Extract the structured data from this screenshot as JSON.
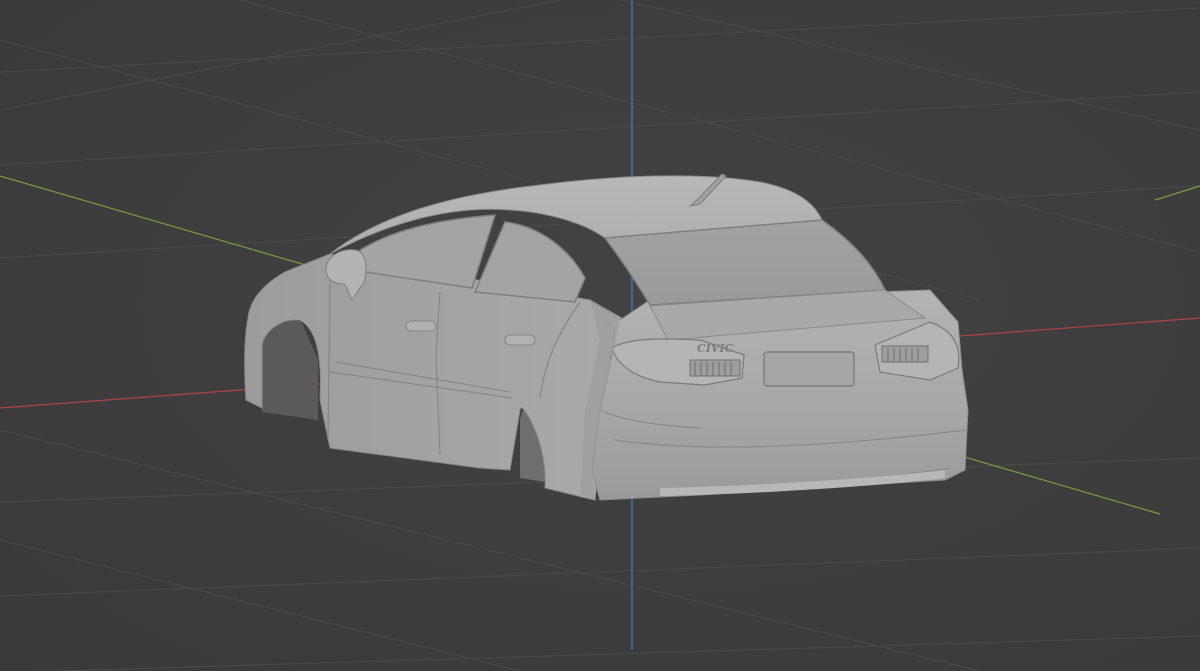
{
  "viewport": {
    "background_color": "#3d3d3d",
    "grid_color": "#4b4b4b",
    "axis_x_color": "#b0444b",
    "axis_y_color": "#7f9a3c",
    "axis_z_color": "#3b79b8",
    "mesh_color": "#a9a9a9"
  },
  "model": {
    "badge_text": "CIVIC"
  }
}
